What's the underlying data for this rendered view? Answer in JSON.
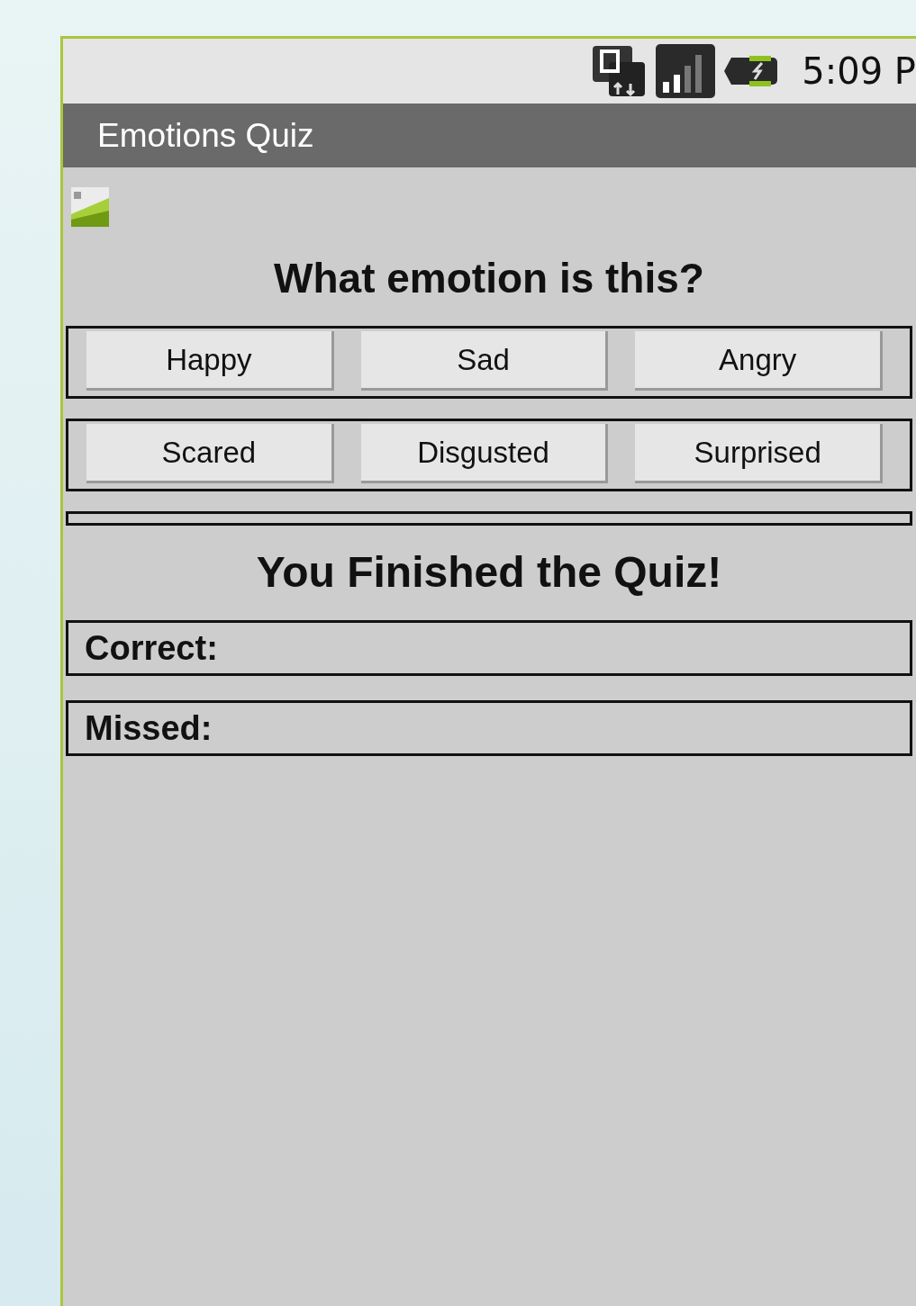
{
  "status_bar": {
    "time": "5:09 P"
  },
  "title_bar": {
    "title": "Emotions Quiz"
  },
  "quiz": {
    "question": "What emotion is this?",
    "answer_rows": [
      [
        "Happy",
        "Sad",
        "Angry"
      ],
      [
        "Scared",
        "Disgusted",
        "Surprised"
      ]
    ],
    "result_title": "You Finished the Quiz!",
    "results": [
      {
        "label": "Correct:"
      },
      {
        "label": "Missed:"
      }
    ]
  }
}
